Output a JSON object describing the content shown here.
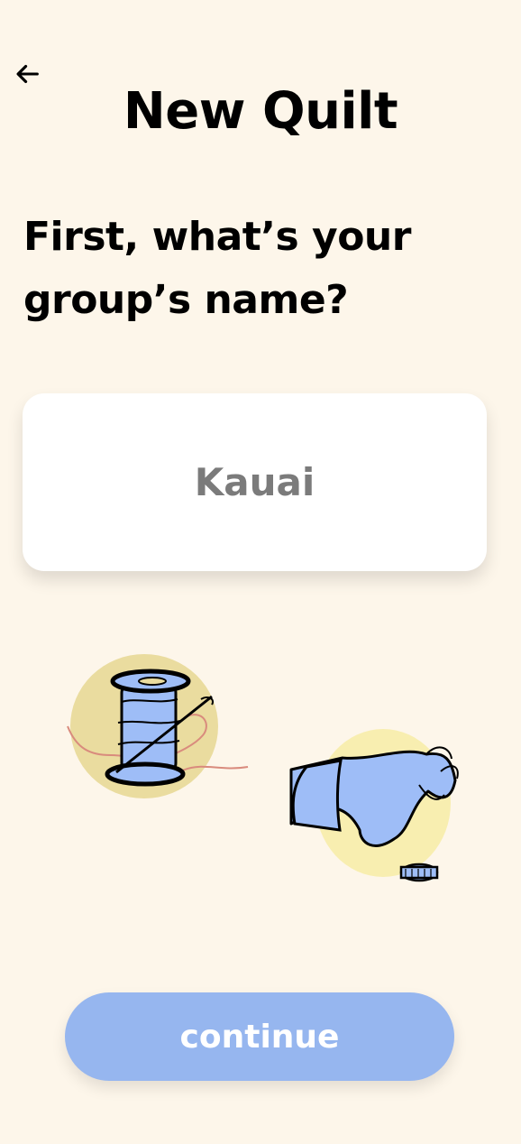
{
  "header": {
    "back_icon": "arrow-left-icon",
    "title": "New Quilt"
  },
  "main": {
    "question": "First, what’s your group’s name?",
    "group_name": {
      "value": "Kauai",
      "placeholder": ""
    },
    "illustrations": [
      "thread-spool-icon",
      "glove-icon",
      "thimble-icon"
    ]
  },
  "footer": {
    "continue_label": "continue"
  },
  "colors": {
    "background": "#fdf6ea",
    "accent": "#96b6ef",
    "text": "#000000",
    "input_text": "#7b7b7b"
  }
}
